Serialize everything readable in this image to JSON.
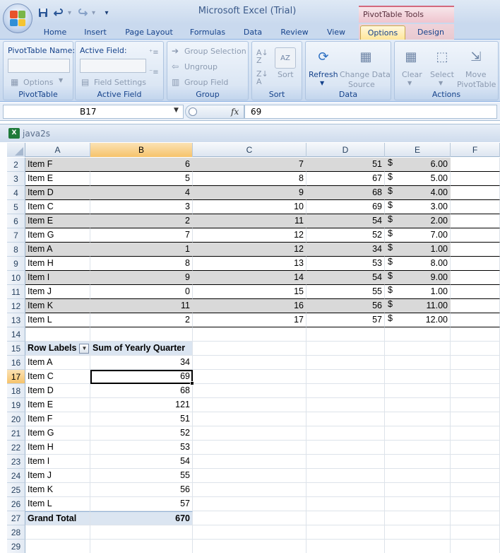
{
  "window": {
    "title": "Microsoft Excel (Trial)",
    "tools_title": "PivotTable Tools"
  },
  "qat": {
    "save_icon": "save-icon",
    "undo_icon": "undo-icon",
    "redo_icon": "redo-icon",
    "customize_icon": "customize-icon"
  },
  "tabs": [
    {
      "label": "Home"
    },
    {
      "label": "Insert"
    },
    {
      "label": "Page Layout"
    },
    {
      "label": "Formulas"
    },
    {
      "label": "Data"
    },
    {
      "label": "Review"
    },
    {
      "label": "View"
    },
    {
      "label": "Options",
      "active": true
    },
    {
      "label": "Design"
    }
  ],
  "ribbon": {
    "pivottable": {
      "name_label": "PivotTable Name:",
      "name_value": "",
      "options_label": "Options",
      "group_label": "PivotTable"
    },
    "active_field": {
      "label": "Active Field:",
      "value": "",
      "field_settings": "Field Settings",
      "group_label": "Active Field"
    },
    "group": {
      "group_selection": "Group Selection",
      "ungroup": "Ungroup",
      "group_field": "Group Field",
      "group_label": "Group"
    },
    "sort": {
      "sort_label": "Sort",
      "group_label": "Sort"
    },
    "data": {
      "refresh": "Refresh",
      "change_source_1": "Change Data",
      "change_source_2": "Source",
      "group_label": "Data"
    },
    "actions": {
      "clear": "Clear",
      "select": "Select",
      "move_1": "Move",
      "move_2": "PivotTable",
      "group_label": "Actions"
    }
  },
  "formula_bar": {
    "name_box": "B17",
    "fx": "fx",
    "formula": "69"
  },
  "workbook": {
    "name": "java2s"
  },
  "columns": [
    "A",
    "B",
    "C",
    "D",
    "E",
    "F"
  ],
  "table_rows": [
    {
      "row": "2",
      "a": "Item F",
      "b": "6",
      "c": "7",
      "d": "51",
      "e": "6.00"
    },
    {
      "row": "3",
      "a": "Item E",
      "b": "5",
      "c": "8",
      "d": "67",
      "e": "5.00"
    },
    {
      "row": "4",
      "a": "Item D",
      "b": "4",
      "c": "9",
      "d": "68",
      "e": "4.00"
    },
    {
      "row": "5",
      "a": "Item C",
      "b": "3",
      "c": "10",
      "d": "69",
      "e": "3.00"
    },
    {
      "row": "6",
      "a": "Item E",
      "b": "2",
      "c": "11",
      "d": "54",
      "e": "2.00"
    },
    {
      "row": "7",
      "a": "Item G",
      "b": "7",
      "c": "12",
      "d": "52",
      "e": "7.00"
    },
    {
      "row": "8",
      "a": "Item A",
      "b": "1",
      "c": "12",
      "d": "34",
      "e": "1.00"
    },
    {
      "row": "9",
      "a": "Item H",
      "b": "8",
      "c": "13",
      "d": "53",
      "e": "8.00"
    },
    {
      "row": "10",
      "a": "Item I",
      "b": "9",
      "c": "14",
      "d": "54",
      "e": "9.00"
    },
    {
      "row": "11",
      "a": "Item J",
      "b": "0",
      "c": "15",
      "d": "55",
      "e": "1.00"
    },
    {
      "row": "12",
      "a": "Item K",
      "b": "11",
      "c": "16",
      "d": "56",
      "e": "11.00"
    },
    {
      "row": "13",
      "a": "Item L",
      "b": "2",
      "c": "17",
      "d": "57",
      "e": "12.00"
    }
  ],
  "currency_symbol": "$",
  "blank_row_14": "14",
  "pivot": {
    "header_row": "15",
    "row_labels": "Row Labels",
    "sum_header": "Sum of Yearly Quarter",
    "rows": [
      {
        "row": "16",
        "label": "Item A",
        "value": "34"
      },
      {
        "row": "17",
        "label": "Item C",
        "value": "69"
      },
      {
        "row": "18",
        "label": "Item D",
        "value": "68"
      },
      {
        "row": "19",
        "label": "Item E",
        "value": "121"
      },
      {
        "row": "20",
        "label": "Item F",
        "value": "51"
      },
      {
        "row": "21",
        "label": "Item G",
        "value": "52"
      },
      {
        "row": "22",
        "label": "Item H",
        "value": "53"
      },
      {
        "row": "23",
        "label": "Item I",
        "value": "54"
      },
      {
        "row": "24",
        "label": "Item J",
        "value": "55"
      },
      {
        "row": "25",
        "label": "Item K",
        "value": "56"
      },
      {
        "row": "26",
        "label": "Item L",
        "value": "57"
      }
    ],
    "total_row": "27",
    "total_label": "Grand Total",
    "total_value": "670"
  },
  "trailing_rows": [
    "28",
    "29"
  ],
  "selection": {
    "cell": "B17",
    "row": "17",
    "column": "B"
  },
  "colors": {
    "band": "#d9d9d9",
    "pivot_header": "#dbe5f1",
    "selected_header": "#f6c36b",
    "ribbon": "#dbe6f4"
  }
}
